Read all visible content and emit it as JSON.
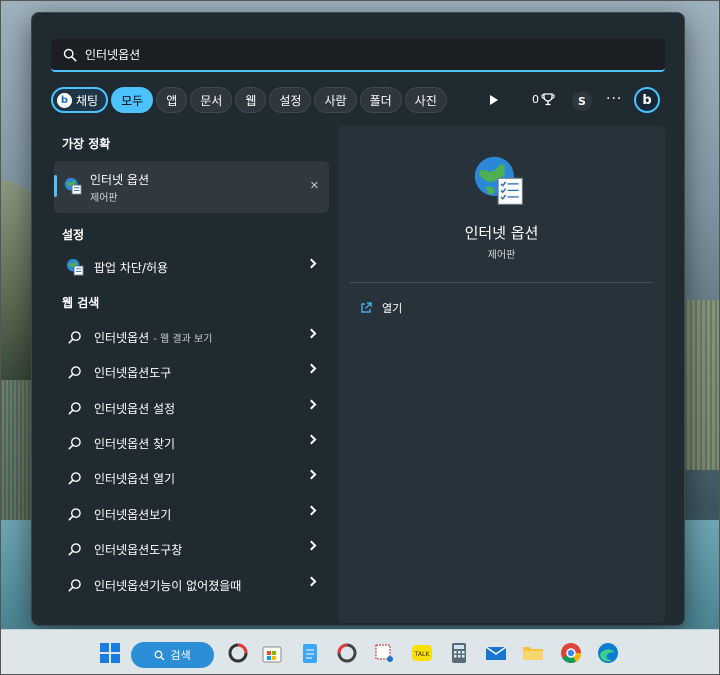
{
  "search": {
    "query": "인터넷옵션"
  },
  "filters": {
    "chat_label": "채팅",
    "items": [
      "모두",
      "앱",
      "문서",
      "웹",
      "설정",
      "사람",
      "폴더",
      "사진"
    ],
    "active": "모두",
    "score": "0",
    "avatar_letter": "S"
  },
  "sections": {
    "best_match": "가장 정확",
    "settings": "설정",
    "web_search": "웹 검색"
  },
  "best_match": {
    "title": "인터넷 옵션",
    "subtitle": "제어판"
  },
  "settings_items": [
    {
      "label": "팝업 차단/허용"
    }
  ],
  "web_items": [
    {
      "label": "인터넷옵션",
      "suffix": "- 웹 결과 보기"
    },
    {
      "label": "인터넷옵션도구"
    },
    {
      "label": "인터넷옵션 설정"
    },
    {
      "label": "인터넷옵션 찾기"
    },
    {
      "label": "인터넷옵션 열기"
    },
    {
      "label": "인터넷옵션보기"
    },
    {
      "label": "인터넷옵션도구창"
    },
    {
      "label": "인터넷옵션기능이 없어졌을때"
    }
  ],
  "detail": {
    "title": "인터넷 옵션",
    "subtitle": "제어판",
    "open_label": "열기"
  },
  "taskbar": {
    "search_label": "검색"
  },
  "colors": {
    "accent": "#4cc2ff",
    "panel": "#202a31",
    "taskbar": "#dfe6ea"
  }
}
